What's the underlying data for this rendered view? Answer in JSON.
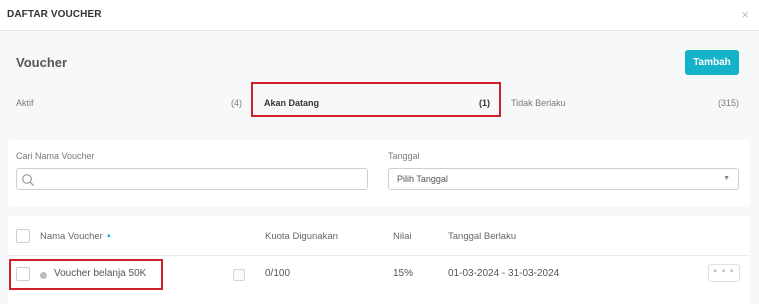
{
  "modal": {
    "title": "DAFTAR VOUCHER",
    "close_icon": "×"
  },
  "section": {
    "title": "Voucher",
    "add_label": "Tambah",
    "accent_color": "#14b3c9"
  },
  "tabs": [
    {
      "label": "Aktif",
      "count": "(4)",
      "active": false
    },
    {
      "label": "Akan Datang",
      "count": "(1)",
      "active": true
    },
    {
      "label": "Tidak Berlaku",
      "count": "(315)",
      "active": false
    }
  ],
  "filters": {
    "search_label": "Cari Nama Voucher",
    "search_value": "",
    "date_label": "Tanggal",
    "date_selected": "Pilih Tanggal",
    "caret_icon": "▼"
  },
  "table": {
    "headers": {
      "name": "Nama Voucher",
      "sort_icon": "▲",
      "quota": "Kuota Digunakan",
      "value": "Nilai",
      "validity": "Tanggal Berlaku"
    },
    "rows": [
      {
        "name": "Voucher belanja 50K",
        "quota": "0/100",
        "value": "15%",
        "validity": "01-03-2024 - 31-03-2024",
        "more": "• • •"
      }
    ]
  },
  "highlight_color": "#d0202a"
}
